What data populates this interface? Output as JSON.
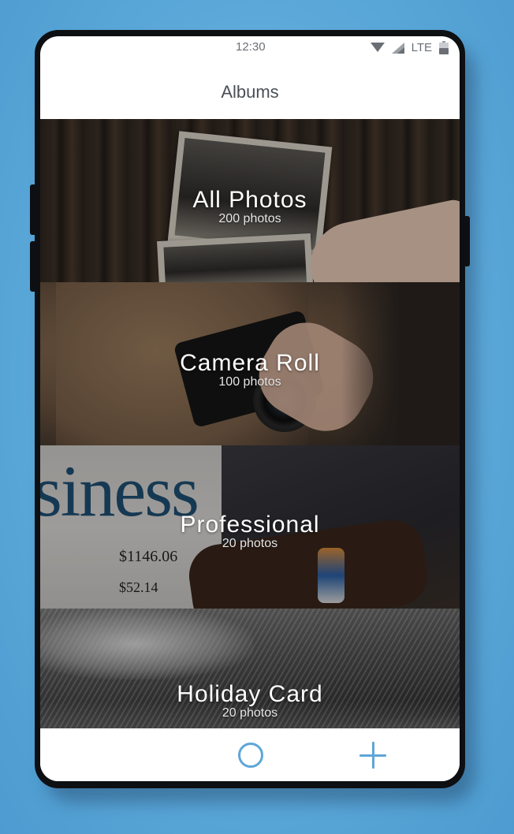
{
  "status_bar": {
    "time": "12:30",
    "network": "LTE"
  },
  "header": {
    "title": "Albums"
  },
  "albums": [
    {
      "title": "All Photos",
      "count": "200 photos"
    },
    {
      "title": "Camera Roll",
      "count": "100 photos"
    },
    {
      "title": "Professional",
      "count": "20 photos"
    },
    {
      "title": "Holiday Card",
      "count": "20 photos"
    }
  ],
  "bottom_nav": {
    "items": [
      {
        "icon": "circle-icon"
      },
      {
        "icon": "plus-icon"
      }
    ]
  },
  "colors": {
    "accent": "#5ea6d8",
    "background": "#5aa7d8",
    "title_text": "#4a4f55"
  }
}
